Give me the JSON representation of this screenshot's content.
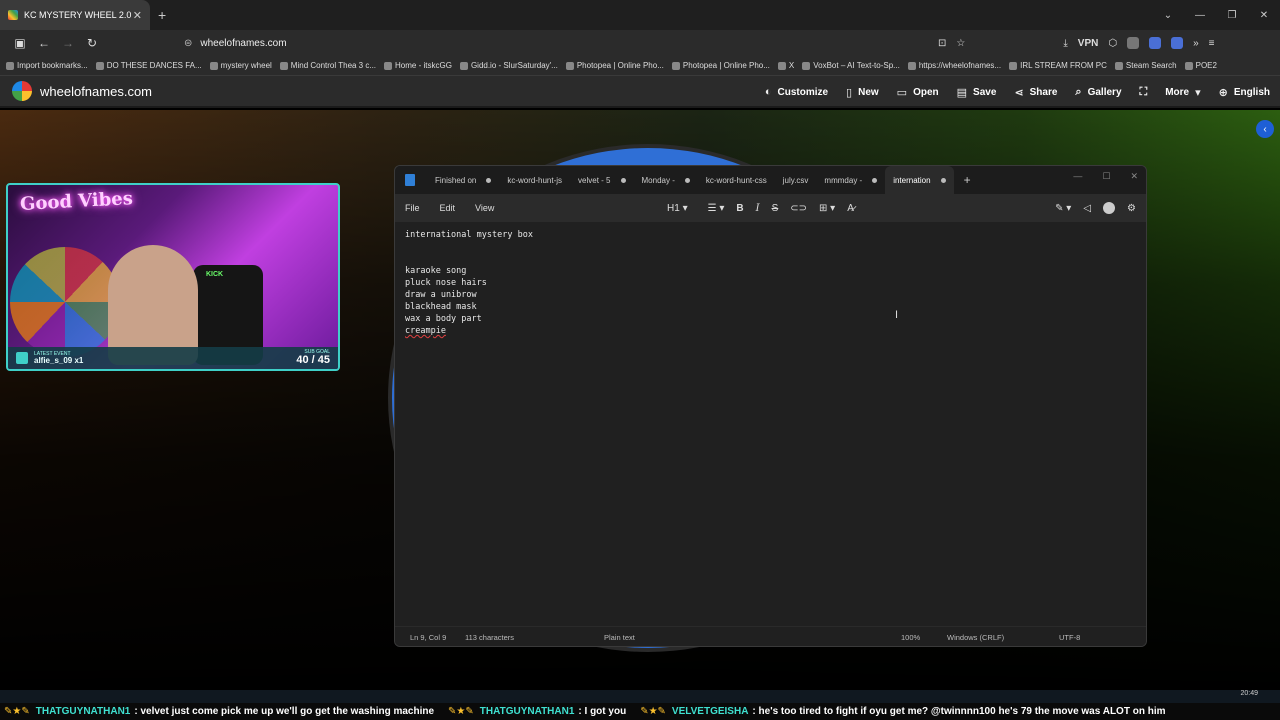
{
  "browser": {
    "tab_title": "KC MYSTERY WHEEL 2.0",
    "url": "wheelofnames.com",
    "vpn_label": "VPN",
    "bookmarks": [
      "Import bookmarks...",
      "DO THESE DANCES FA...",
      "mystery wheel",
      "Mind Control Thea 3 c...",
      "Home - itskcGG",
      "Gidd.io - SlurSaturday'...",
      "Photopea | Online Pho...",
      "Photopea | Online Pho...",
      "X",
      "VoxBot – AI Text-to-Sp...",
      "https://wheelofnames...",
      "IRL STREAM FROM PC",
      "Steam Search",
      "POE2"
    ]
  },
  "site": {
    "name": "wheelofnames.com",
    "menu": [
      "Customize",
      "New",
      "Open",
      "Save",
      "Share",
      "Gallery",
      "More",
      "English"
    ]
  },
  "overlay": {
    "neon_text": "Good Vibes",
    "chair_brand": "KICK",
    "latest_event_label": "LATEST EVENT",
    "latest_event": "alfie_s_09 x1",
    "sub_goal_label": "SUB GOAL",
    "sub_goal": "40 / 45"
  },
  "notepad": {
    "tabs": [
      "Finished on",
      "kc-word-hunt-js",
      "velvet - 5",
      "Monday -",
      "kc-word-hunt-css",
      "july.csv",
      "mmmday -",
      "internation"
    ],
    "menu": [
      "File",
      "Edit",
      "View"
    ],
    "heading_label": "H1",
    "lines": [
      "international mystery box",
      "",
      "",
      "karaoke song",
      "pluck nose hairs",
      "draw a unibrow",
      "blackhead mask",
      "wax a body part",
      "creampie"
    ],
    "status": {
      "position": "Ln 9, Col 9",
      "chars": "113 characters",
      "mode": "Plain text",
      "zoom": "100%",
      "eol": "Windows (CRLF)",
      "encoding": "UTF-8"
    }
  },
  "chat": [
    {
      "user": "THATGUYNATHAN1",
      "message": "velvet just come pick me up we'll go get the washing machine"
    },
    {
      "user": "THATGUYNATHAN1",
      "message": "I got you"
    },
    {
      "user": "VELVETGEISHA",
      "message": "he's too tired to fight if oyu get me? @twinnnn100 he's 79 the move was ALOT on him"
    }
  ],
  "clock": "20:49"
}
